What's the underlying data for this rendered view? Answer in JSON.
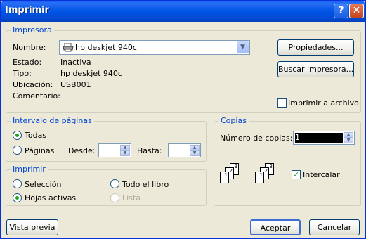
{
  "window": {
    "title": "Imprimir",
    "help_glyph": "?",
    "close_glyph": "✕"
  },
  "printer": {
    "legend": "Impresora",
    "name_label": "Nombre:",
    "name_value": "hp deskjet 940c",
    "status_label": "Estado:",
    "status_value": "Inactiva",
    "type_label": "Tipo:",
    "type_value": "hp deskjet 940c",
    "location_label": "Ubicación:",
    "location_value": "USB001",
    "comment_label": "Comentario:",
    "properties_button": "Propiedades...",
    "find_printer_button": "Buscar impresora...",
    "print_to_file_label": "Imprimir a archivo",
    "print_to_file_checked": false
  },
  "page_range": {
    "legend": "Intervalo de páginas",
    "all_label": "Todas",
    "all_selected": true,
    "pages_label": "Páginas",
    "pages_selected": false,
    "from_label": "Desde:",
    "from_value": "",
    "to_label": "Hasta:",
    "to_value": ""
  },
  "print_what": {
    "legend": "Imprimir",
    "selection_label": "Selección",
    "entire_workbook_label": "Todo el libro",
    "active_sheets_label": "Hojas activas",
    "active_sheets_selected": true,
    "list_label": "Lista"
  },
  "copies": {
    "legend": "Copias",
    "number_label": "Número de copias:",
    "number_value": "1",
    "collate_label": "Intercalar",
    "collate_checked": true
  },
  "footer": {
    "preview_button": "Vista previa",
    "accept_button": "Aceptar",
    "cancel_button": "Cancelar"
  }
}
